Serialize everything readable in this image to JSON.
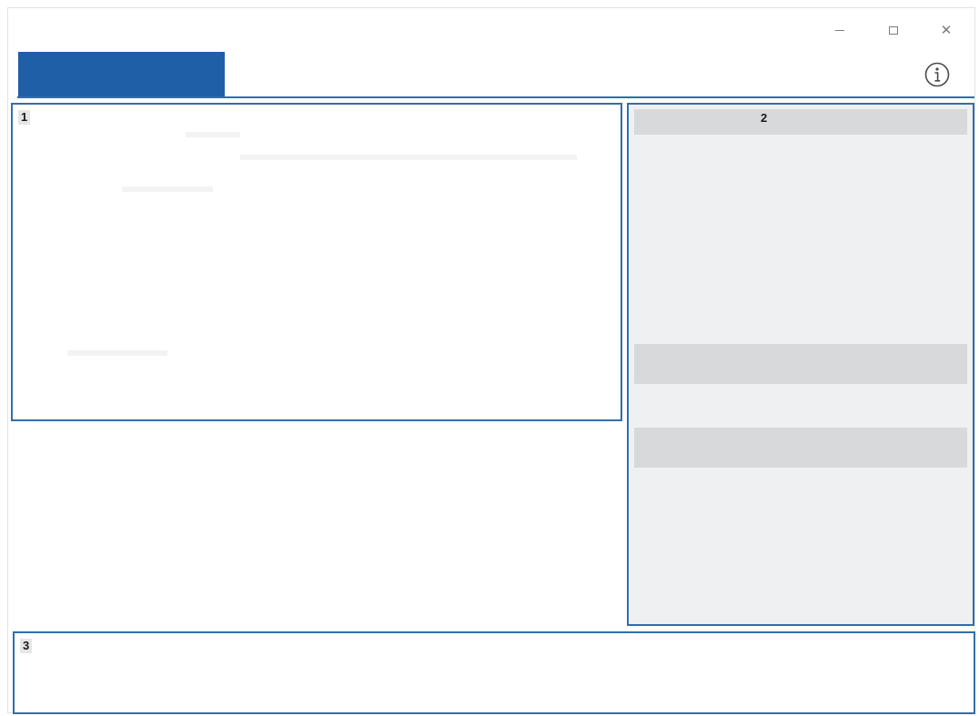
{
  "window": {
    "controls": {
      "minimize": "–",
      "maximize": "□",
      "close": "×"
    }
  },
  "tabs": {
    "active_color": "#1f5fa8"
  },
  "header": {
    "info_icon": "info-icon"
  },
  "regions": [
    {
      "label": "1"
    },
    {
      "label": "2"
    },
    {
      "label": "3"
    }
  ],
  "colors": {
    "accent": "#2f6fad",
    "panel_bg": "#eef0f2",
    "panel_bar": "#d7d9db"
  }
}
